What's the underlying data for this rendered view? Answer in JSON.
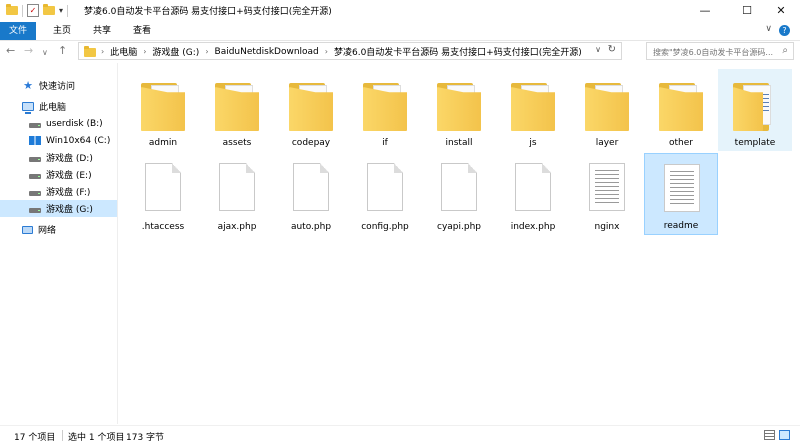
{
  "window": {
    "title": "梦凌6.0自动发卡平台源码 易支付接口+码支付接口(完全开源)",
    "qat_dropdown": "▾",
    "minimize": "—",
    "maximize": "☐",
    "close": "✕"
  },
  "ribbon": {
    "tabs": [
      "文件",
      "主页",
      "共享",
      "查看"
    ],
    "expand_glyph": "∨",
    "help_glyph": "?"
  },
  "nav": {
    "back": "←",
    "forward": "→",
    "recent": "∨",
    "up": "↑"
  },
  "address": {
    "crumbs": [
      "此电脑",
      "游戏盘 (G:)",
      "BaiduNetdiskDownload",
      "梦凌6.0自动发卡平台源码 易支付接口+码支付接口(完全开源)"
    ],
    "separator": "›",
    "dropdown": "∨",
    "refresh": "↻"
  },
  "search": {
    "placeholder": "搜索\"梦凌6.0自动发卡平台源码...",
    "icon": "⌕"
  },
  "sidebar": {
    "items": [
      {
        "label": "快速访问",
        "icon": "star-icon"
      },
      {
        "label": "此电脑",
        "icon": "computer-icon"
      },
      {
        "label": "userdisk (B:)",
        "icon": "drive-icon"
      },
      {
        "label": "Win10x64 (C:)",
        "icon": "windows-drive-icon"
      },
      {
        "label": "游戏盘 (D:)",
        "icon": "drive-icon"
      },
      {
        "label": "游戏盘 (E:)",
        "icon": "drive-icon"
      },
      {
        "label": "游戏盘 (F:)",
        "icon": "drive-icon"
      },
      {
        "label": "游戏盘 (G:)",
        "icon": "drive-icon",
        "selected": true
      },
      {
        "label": "网络",
        "icon": "network-icon"
      }
    ]
  },
  "files": [
    {
      "name": "admin",
      "type": "folder"
    },
    {
      "name": "assets",
      "type": "folder"
    },
    {
      "name": "codepay",
      "type": "folder"
    },
    {
      "name": "if",
      "type": "folder"
    },
    {
      "name": "install",
      "type": "folder"
    },
    {
      "name": "js",
      "type": "folder"
    },
    {
      "name": "layer",
      "type": "folder"
    },
    {
      "name": "other",
      "type": "folder"
    },
    {
      "name": "template",
      "type": "folder",
      "state": "hover"
    },
    {
      "name": ".htaccess",
      "type": "file"
    },
    {
      "name": "ajax.php",
      "type": "file"
    },
    {
      "name": "auto.php",
      "type": "file"
    },
    {
      "name": "config.php",
      "type": "file"
    },
    {
      "name": "cyapi.php",
      "type": "file"
    },
    {
      "name": "index.php",
      "type": "file"
    },
    {
      "name": "nginx",
      "type": "text"
    },
    {
      "name": "readme",
      "type": "text",
      "state": "selected"
    }
  ],
  "status": {
    "item_count": "17 个项目",
    "selection": "选中 1 个项目",
    "size": "173 字节"
  }
}
